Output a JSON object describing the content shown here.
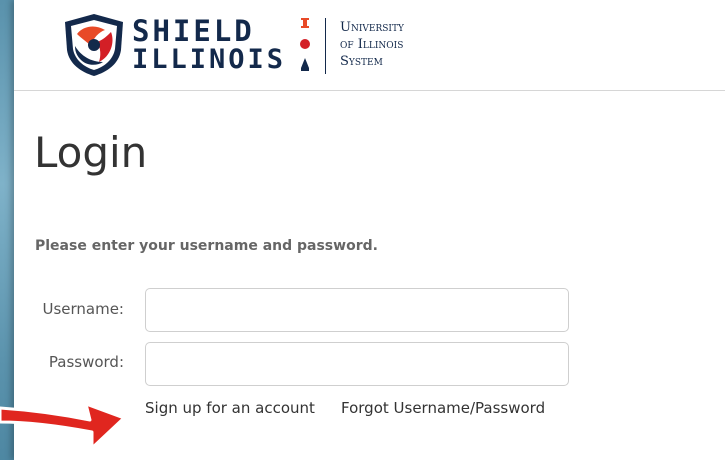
{
  "header": {
    "shield_line1": "SHIELD",
    "shield_line2": "ILLINOIS",
    "university_line1": "University",
    "university_line2": "of Illinois",
    "university_line3": "System"
  },
  "main": {
    "title": "Login",
    "instructions": "Please enter your username and password.",
    "username_label": "Username:",
    "password_label": "Password:",
    "username_value": "",
    "password_value": "",
    "signup_link": "Sign up for an account",
    "forgot_link": "Forgot Username/Password"
  },
  "colors": {
    "navy": "#13294b",
    "orange": "#e84a27",
    "red": "#d31f26",
    "arrow_red": "#e0261f",
    "background": "#5b93ad"
  },
  "icons": {
    "logo": "shield-illinois-logo-icon",
    "uni": "university-campus-icons",
    "arrow": "red-pointer-arrow-icon"
  }
}
